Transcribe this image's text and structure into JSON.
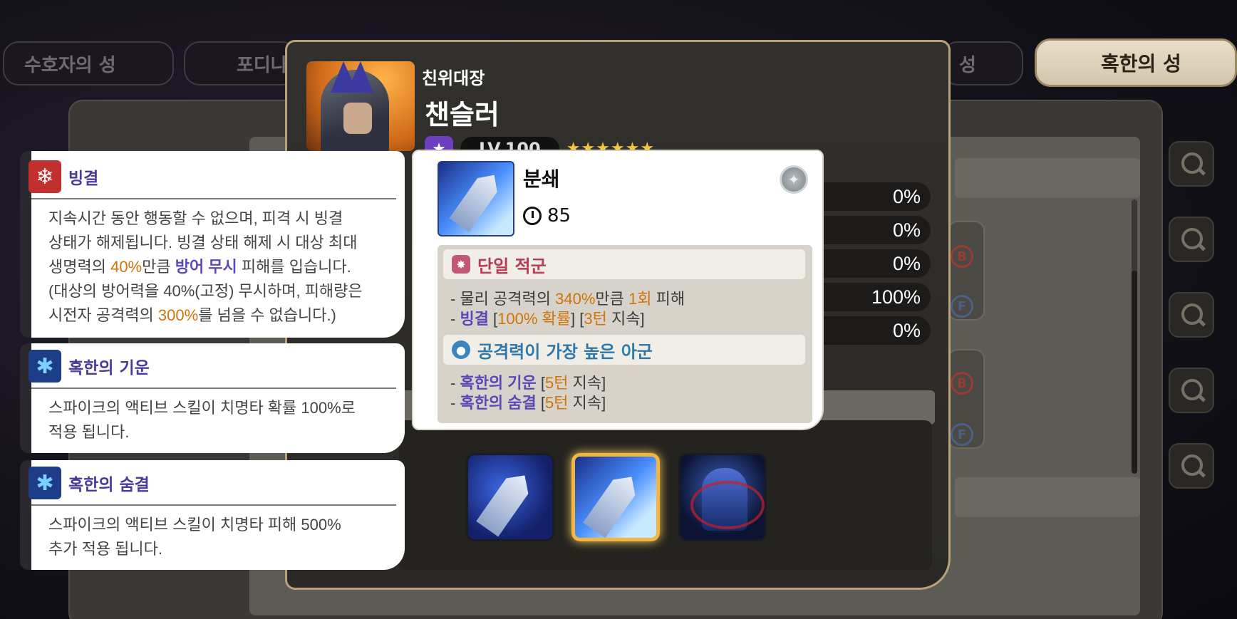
{
  "background": {
    "tabs": [
      "수호자의 성",
      "포디나",
      "성",
      "혹한의 성"
    ],
    "badges": [
      "B",
      "F",
      "B",
      "F"
    ]
  },
  "hero": {
    "subtitle": "친위대장",
    "name": "챈슬러",
    "level": "LV.100",
    "star_count": 6,
    "stats": [
      "0%",
      "0%",
      "0%",
      "100%",
      "0%"
    ]
  },
  "skill": {
    "name": "분쇄",
    "cooldown": "85",
    "target_enemy": "단일 적군",
    "enemy_effects": {
      "line1": {
        "prefix": "- 물리 공격력의 ",
        "pct": "340%",
        "mid": "만큼 ",
        "hits": "1회",
        "suffix": " 피해"
      },
      "line2": {
        "prefix": "- ",
        "buff": "빙결",
        "b1": " [",
        "chance": "100% 확률",
        "b2": "] [",
        "turns": "3턴",
        "suffix": " 지속]"
      }
    },
    "target_ally": "공격력이 가장 높은 아군",
    "ally_effects": [
      {
        "prefix": "- ",
        "buff": "혹한의 기운",
        "b1": " [",
        "turns": "5턴",
        "suffix": " 지속]"
      },
      {
        "prefix": "- ",
        "buff": "혹한의 숨결",
        "b1": " [",
        "turns": "5턴",
        "suffix": " 지속]"
      }
    ]
  },
  "tooltips": {
    "freeze": {
      "title": "빙결",
      "l1": "지속시간 동안 행동할 수 없으며, 피격 시 빙결",
      "l2": "상태가 해제됩니다. 빙결 상태 해제 시 대상 최대",
      "l3_a": "생명력의 ",
      "l3_pct": "40%",
      "l3_b": "만큼 ",
      "l3_key": "방어 무시",
      "l3_c": " 피해를 입습니다.",
      "l4": "(대상의 방어력을 40%(고정) 무시하며, 피해량은",
      "l5_a": "시전자 공격력의 ",
      "l5_pct": "300%",
      "l5_b": "를 넘을 수 없습니다.)"
    },
    "cold_spirit": {
      "title": "혹한의 기운",
      "l1": "스파이크의 액티브 스킬이 치명타 확률 100%로",
      "l2": "적용 됩니다."
    },
    "cold_breath": {
      "title": "혹한의 숨결",
      "l1": "스파이크의 액티브 스킬이 치명타 피해 500%",
      "l2": "추가 적용 됩니다."
    }
  },
  "colors": {
    "gold": "#f3b642",
    "orange": "#d0740a",
    "purple": "#5b48b8",
    "enemy": "#b63b55",
    "ally": "#2f78a8"
  }
}
